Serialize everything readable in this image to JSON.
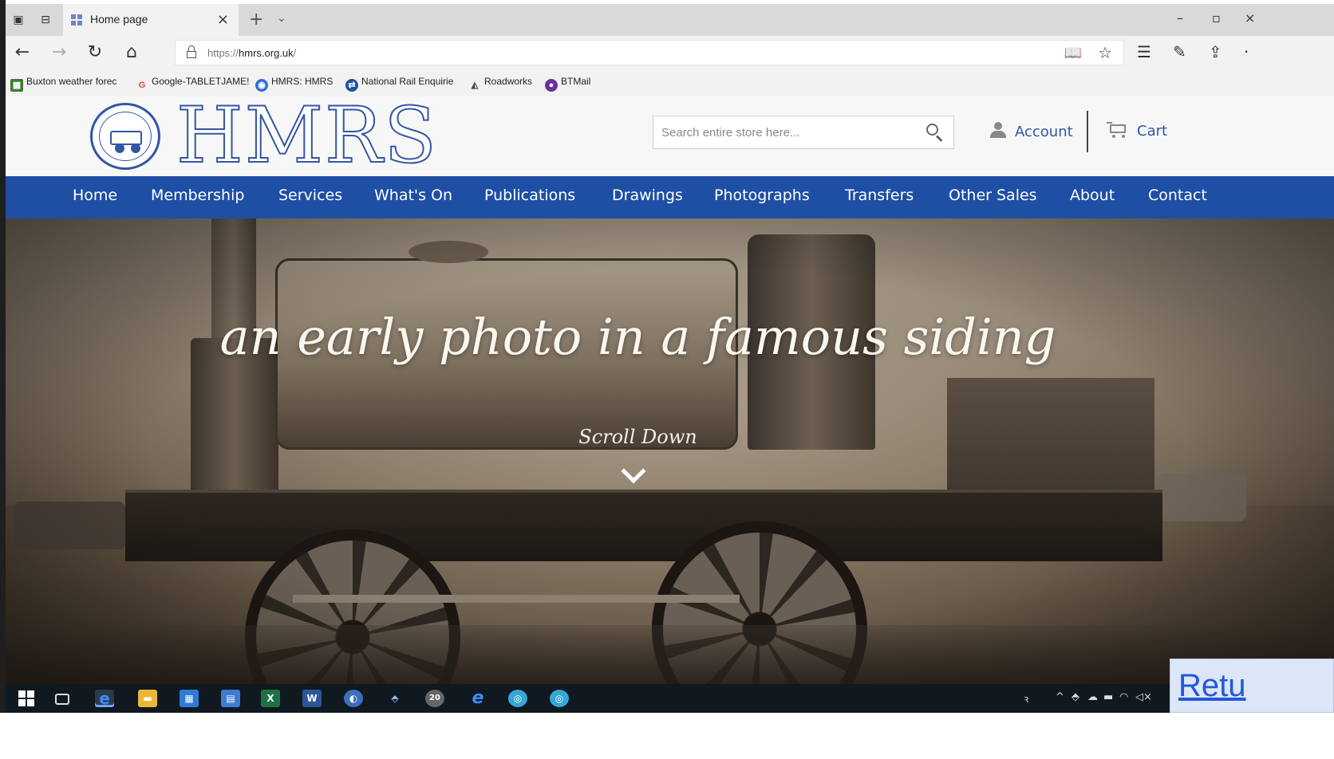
{
  "browser": {
    "tab": {
      "title": "Home page"
    },
    "address": {
      "url_prefix": "https://",
      "url_domain": "hmrs.org.uk",
      "url_suffix": "/"
    },
    "favorites": [
      {
        "label": "Buxton weather forec",
        "icon": "weather-icon",
        "color": "#3a7d2c"
      },
      {
        "label": "Google-TABLETJAME!",
        "icon": "google-icon",
        "color": "#ea4335"
      },
      {
        "label": "HMRS: HMRS",
        "icon": "globe-icon",
        "color": "#2f6fd6"
      },
      {
        "label": "National Rail Enquirie",
        "icon": "rail-icon",
        "color": "#1f4fa5"
      },
      {
        "label": "Roadworks",
        "icon": "roadworks-icon",
        "color": "#444444"
      },
      {
        "label": "BTMail",
        "icon": "bt-icon",
        "color": "#6b2fa0"
      }
    ]
  },
  "header": {
    "logo_text": "HMRS",
    "search_placeholder": "Search entire store here...",
    "account_label": "Account",
    "cart_label": "Cart"
  },
  "nav": {
    "items": [
      "Home",
      "Membership",
      "Services",
      "What's On",
      "Publications",
      "Drawings",
      "Photographs",
      "Transfers",
      "Other Sales",
      "About",
      "Contact"
    ]
  },
  "hero": {
    "tagline": "an early photo in a famous siding",
    "scroll_label": "Scroll Down"
  },
  "taskbar": {
    "clock_badge": "20"
  },
  "return_button": {
    "label": "Retu"
  },
  "colors": {
    "nav_bg": "#1f4fa5",
    "link": "#2c56a8",
    "logo_stroke": "#3356a4"
  }
}
